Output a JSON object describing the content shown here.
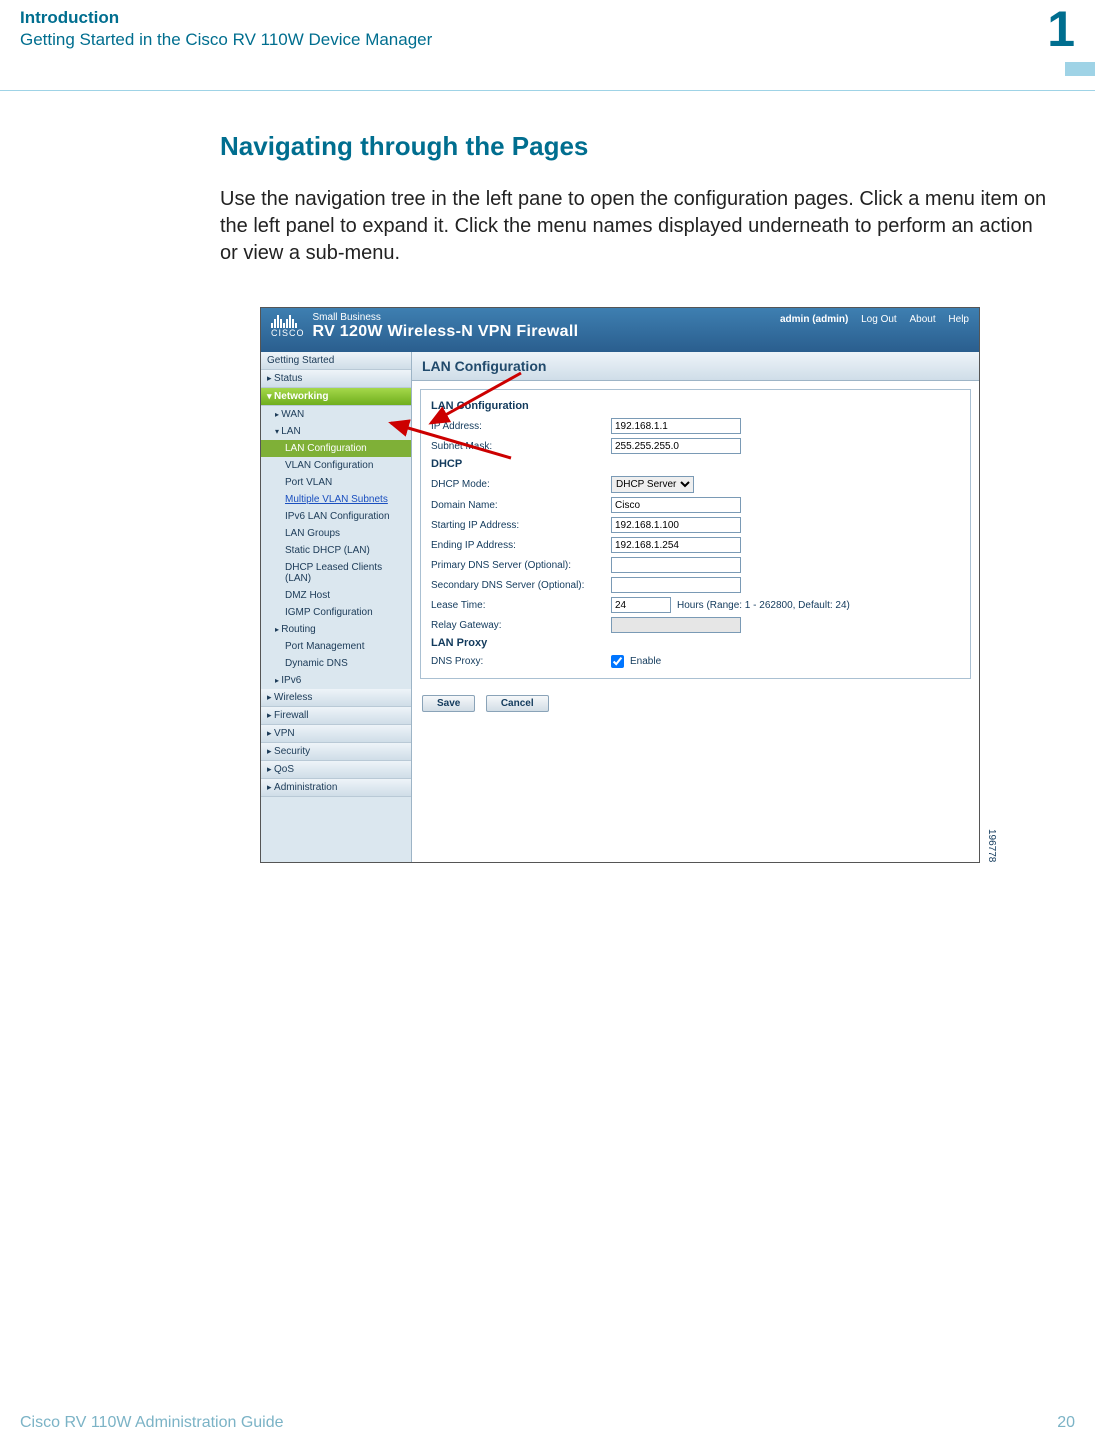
{
  "header": {
    "title": "Introduction",
    "subtitle": "Getting Started in the Cisco RV 110W Device Manager",
    "chapter_number": "1"
  },
  "section": {
    "title": "Navigating through the Pages",
    "body": "Use the navigation tree in the left pane to open the configuration pages. Click a menu item on the left panel to expand it. Click the menu names displayed underneath to perform an action or view a sub-menu."
  },
  "screenshot": {
    "brand_small": "Small Business",
    "brand_big": "RV 120W Wireless-N VPN Firewall",
    "brand_cisco": "CISCO",
    "top_links": {
      "admin": "admin (admin)",
      "logout": "Log Out",
      "about": "About",
      "help": "Help"
    },
    "nav": {
      "getting_started": "Getting Started",
      "status": "Status",
      "networking": "Networking",
      "wan": "WAN",
      "lan": "LAN",
      "lan_items": {
        "lan_config": "LAN Configuration",
        "vlan_config": "VLAN Configuration",
        "port_vlan": "Port VLAN",
        "multiple_vlan": "Multiple VLAN Subnets",
        "ipv6_lan": "IPv6 LAN Configuration",
        "lan_groups": "LAN Groups",
        "static_dhcp": "Static DHCP (LAN)",
        "dhcp_leased": "DHCP Leased Clients (LAN)",
        "dmz_host": "DMZ Host",
        "igmp": "IGMP Configuration"
      },
      "routing": "Routing",
      "port_mgmt": "Port Management",
      "dyn_dns": "Dynamic DNS",
      "ipv6": "IPv6",
      "wireless": "Wireless",
      "firewall": "Firewall",
      "vpn": "VPN",
      "security": "Security",
      "qos": "QoS",
      "admin": "Administration"
    },
    "main": {
      "title": "LAN Configuration",
      "group1": "LAN Configuration",
      "ip_label": "IP Address:",
      "ip_value": "192.168.1.1",
      "mask_label": "Subnet Mask:",
      "mask_value": "255.255.255.0",
      "group2": "DHCP",
      "dhcp_mode_label": "DHCP Mode:",
      "dhcp_mode_value": "DHCP Server",
      "domain_label": "Domain Name:",
      "domain_value": "Cisco",
      "start_ip_label": "Starting IP Address:",
      "start_ip_value": "192.168.1.100",
      "end_ip_label": "Ending IP Address:",
      "end_ip_value": "192.168.1.254",
      "pdns_label": "Primary DNS Server   (Optional):",
      "sdns_label": "Secondary DNS Server   (Optional):",
      "lease_label": "Lease Time:",
      "lease_value": "24",
      "lease_hint": "Hours (Range: 1 - 262800, Default: 24)",
      "relay_label": "Relay Gateway:",
      "group3": "LAN Proxy",
      "dns_proxy_label": "DNS Proxy:",
      "dns_proxy_enable": "Enable",
      "save": "Save",
      "cancel": "Cancel"
    },
    "image_id": "196778"
  },
  "footer": {
    "guide": "Cisco RV 110W Administration Guide",
    "page": "20"
  }
}
